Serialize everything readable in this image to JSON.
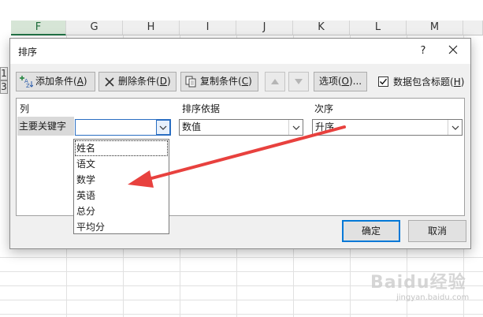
{
  "sheet": {
    "columns": [
      "F",
      "G",
      "H",
      "I",
      "J",
      "K",
      "L",
      "M"
    ],
    "row_labels": [
      "1",
      "3"
    ]
  },
  "dialog": {
    "title": "排序",
    "help_label": "?",
    "toolbar": {
      "add_level": "添加条件(",
      "add_level_key": "A",
      "add_level_end": ")",
      "delete_level": "删除条件(",
      "delete_level_key": "D",
      "delete_level_end": ")",
      "copy_level": "复制条件(",
      "copy_level_key": "C",
      "copy_level_end": ")",
      "options": "选项(",
      "options_key": "O",
      "options_end": ")...",
      "has_headers_label": "数据包含标题(",
      "has_headers_key": "H",
      "has_headers_end": ")",
      "has_headers_checked": true
    },
    "headers": {
      "column": "列",
      "sort_on": "排序依据",
      "order": "次序"
    },
    "level": {
      "label": "主要关键字",
      "column_value": "",
      "sort_on_value": "数值",
      "order_value": "升序"
    },
    "dropdown_options": [
      "姓名",
      "语文",
      "数学",
      "英语",
      "总分",
      "平均分"
    ],
    "ok_label": "确定",
    "cancel_label": "取消"
  },
  "watermark": {
    "text": "Baidu经验",
    "sub": "jingyan.baidu.com"
  },
  "colors": {
    "annotation_arrow": "#e8413e",
    "focus_blue": "#0078d7"
  }
}
